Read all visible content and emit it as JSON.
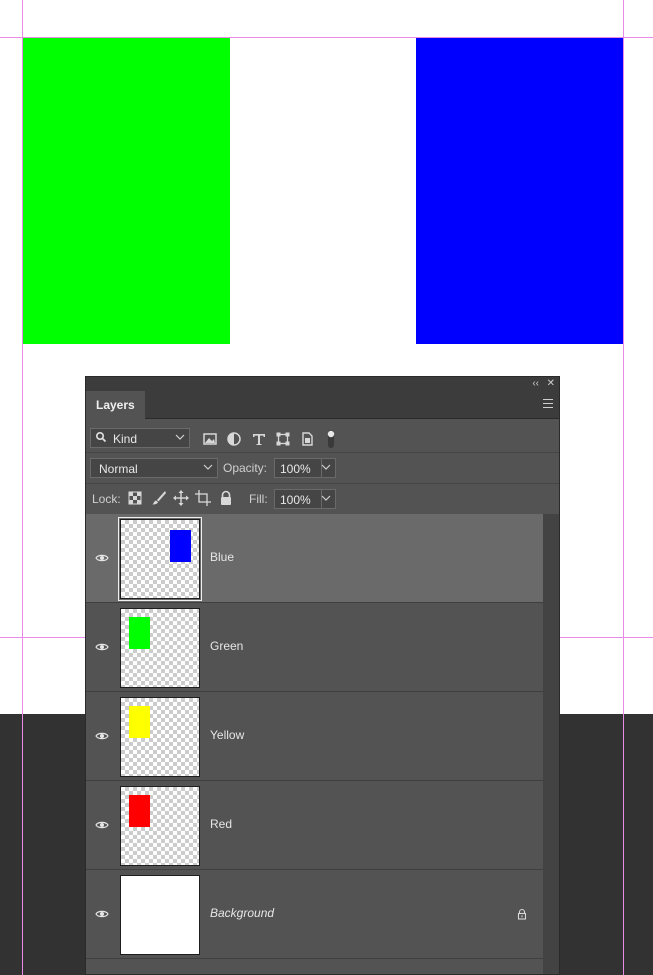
{
  "canvas": {
    "colors": {
      "white": "#ffffff",
      "dark": "#323232",
      "guide": "#e98ae9"
    },
    "rects": [
      {
        "name": "green-rectangle",
        "color": "#00ff00"
      },
      {
        "name": "blue-rectangle",
        "color": "#0000ff"
      }
    ]
  },
  "panel": {
    "collapse_glyph": "‹‹",
    "close_glyph": "✕",
    "tab_label": "Layers",
    "filter": {
      "kind_label": "Kind"
    },
    "blend": {
      "mode": "Normal",
      "opacity_label": "Opacity:",
      "opacity_value": "100%"
    },
    "lock": {
      "lock_label": "Lock:",
      "fill_label": "Fill:",
      "fill_value": "100%"
    },
    "layers": [
      {
        "name": "Blue",
        "swatch": "#0000ff",
        "selected": true,
        "locked": false
      },
      {
        "name": "Green",
        "swatch": "#00ff00",
        "selected": false,
        "locked": false
      },
      {
        "name": "Yellow",
        "swatch": "#ffff00",
        "selected": false,
        "locked": false
      },
      {
        "name": "Red",
        "swatch": "#ff0000",
        "selected": false,
        "locked": false
      },
      {
        "name": "Background",
        "swatch": "#ffffff",
        "selected": false,
        "locked": true
      }
    ]
  }
}
